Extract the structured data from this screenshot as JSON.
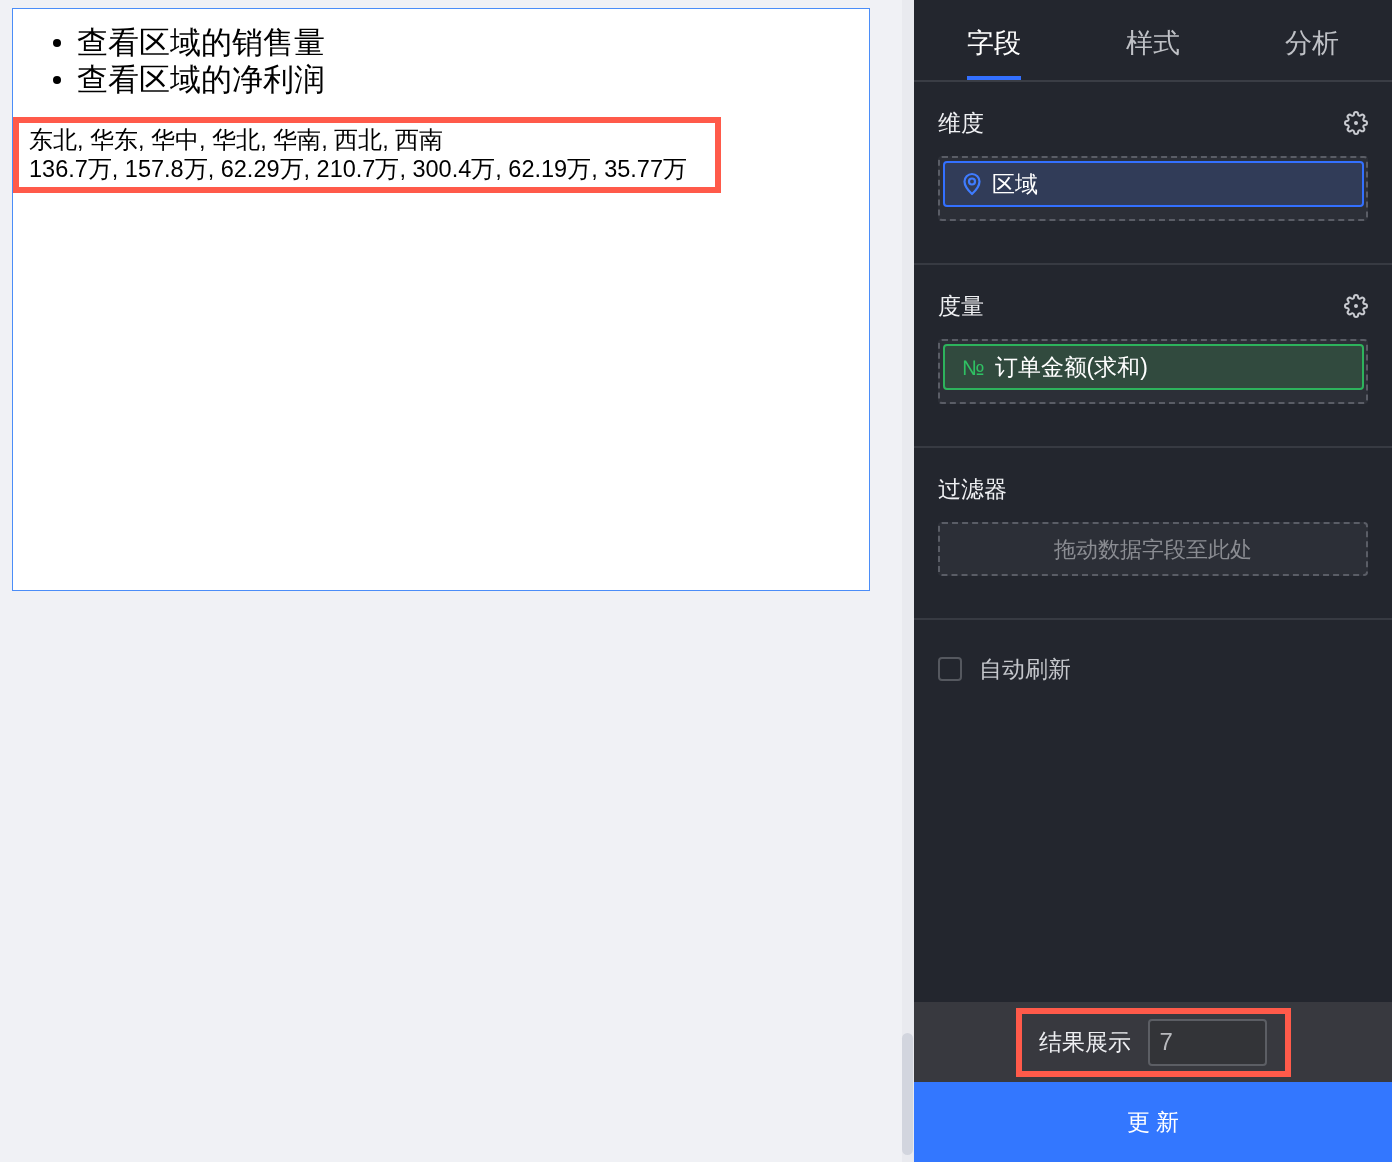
{
  "document": {
    "bullets": [
      "查看区域的销售量",
      "查看区域的净利润"
    ],
    "result": {
      "highlighted": true,
      "lines": [
        "东北, 华东, 华中, 华北, 华南, 西北, 西南",
        "136.7万, 157.8万, 62.29万, 210.7万, 300.4万, 62.19万, 35.77万"
      ]
    }
  },
  "panel": {
    "tabs": [
      {
        "label": "字段",
        "selected": true
      },
      {
        "label": "样式",
        "selected": false
      },
      {
        "label": "分析",
        "selected": false
      }
    ],
    "sections": [
      {
        "kind": "fields",
        "title": "维度",
        "fields": [
          {
            "kind": "dimension",
            "label": "区域"
          }
        ]
      },
      {
        "kind": "fields",
        "title": "度量",
        "fields": [
          {
            "kind": "measure",
            "symbol": "№",
            "label": "订单金额(求和)"
          }
        ]
      },
      {
        "kind": "filter",
        "title": "过滤器",
        "placeholder": "拖动数据字段至此处"
      }
    ],
    "auto_refresh": {
      "label": "自动刷新",
      "checked": false
    },
    "result_display": {
      "label": "结果展示",
      "value": "7",
      "highlighted": true
    },
    "update_button": "更 新"
  }
}
